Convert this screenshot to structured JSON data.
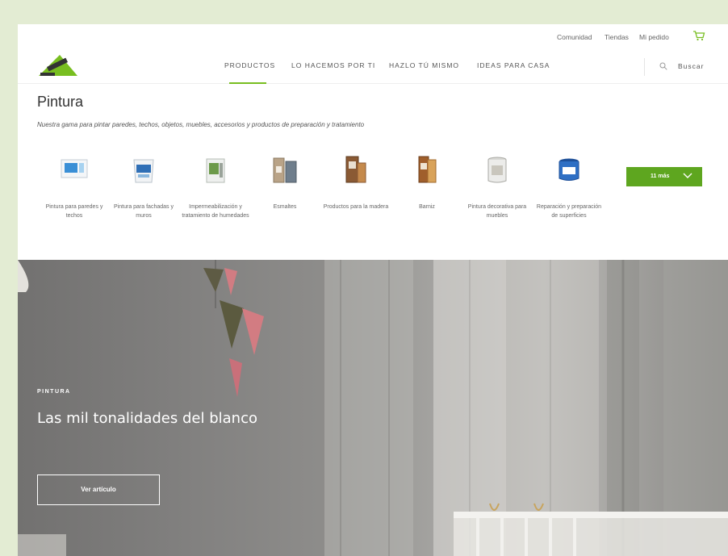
{
  "colors": {
    "accent": "#78be20",
    "button_green": "#5ea61f",
    "page_bg": "#e3ecd3"
  },
  "utility": {
    "links": [
      "Comunidad",
      "Tiendas",
      "Mi pedido"
    ],
    "cart_icon": "cart-icon"
  },
  "nav": {
    "items": [
      "PRODUCTOS",
      "LO HACEMOS POR TI",
      "HAZLO TÚ MISMO",
      "IDEAS PARA CASA"
    ],
    "active": "PRODUCTOS",
    "search_label": "Buscar"
  },
  "category": {
    "title": "Pintura",
    "subtitle": "Nuestra gama para pintar paredes, techos, objetos, muebles, accesorios y productos de preparación y tratamiento",
    "items": [
      {
        "label": "Pintura para paredes y techos"
      },
      {
        "label": "Pintura para fachadas y muros"
      },
      {
        "label": "Impermeabilización y tratamiento de humedades"
      },
      {
        "label": "Esmaltes"
      },
      {
        "label": "Productos para la madera"
      },
      {
        "label": "Barniz"
      },
      {
        "label": "Pintura decorativa para muebles"
      },
      {
        "label": "Reparación y preparación de superficies"
      }
    ],
    "more_label": "11 más"
  },
  "hero": {
    "eyebrow": "PINTURA",
    "title": "Las mil tonalidades del blanco",
    "button": "Ver artículo"
  }
}
